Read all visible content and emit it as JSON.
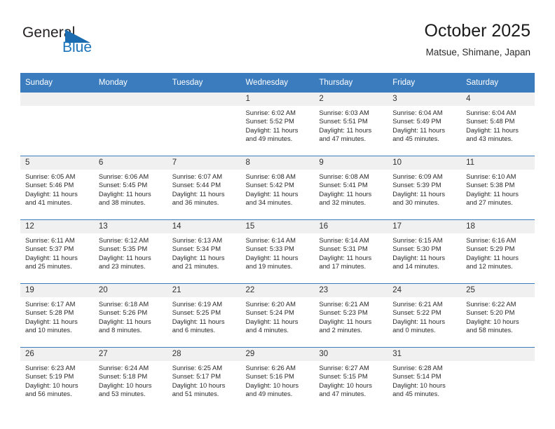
{
  "brand": {
    "name_top": "General",
    "name_bottom": "Blue",
    "triangle_color": "#1b6cb0",
    "blue_text_color": "#1b74bb"
  },
  "header": {
    "title": "October 2025",
    "subtitle": "Matsue, Shimane, Japan"
  },
  "theme": {
    "header_row_bg": "#3a7cbe",
    "daynum_bg": "#f0f0f0",
    "page_bg": "#ffffff",
    "text_color": "#2a2a2a"
  },
  "labels": {
    "sunrise_prefix": "Sunrise:",
    "sunset_prefix": "Sunset:",
    "daylight_prefix": "Daylight:"
  },
  "weekdays": [
    "Sunday",
    "Monday",
    "Tuesday",
    "Wednesday",
    "Thursday",
    "Friday",
    "Saturday"
  ],
  "weeks": [
    [
      {
        "day": "",
        "sunrise": "",
        "sunset": "",
        "daylight": "",
        "blank": true
      },
      {
        "day": "",
        "sunrise": "",
        "sunset": "",
        "daylight": "",
        "blank": true
      },
      {
        "day": "",
        "sunrise": "",
        "sunset": "",
        "daylight": "",
        "blank": true
      },
      {
        "day": "1",
        "sunrise": "Sunrise: 6:02 AM",
        "sunset": "Sunset: 5:52 PM",
        "daylight": "Daylight: 11 hours and 49 minutes."
      },
      {
        "day": "2",
        "sunrise": "Sunrise: 6:03 AM",
        "sunset": "Sunset: 5:51 PM",
        "daylight": "Daylight: 11 hours and 47 minutes."
      },
      {
        "day": "3",
        "sunrise": "Sunrise: 6:04 AM",
        "sunset": "Sunset: 5:49 PM",
        "daylight": "Daylight: 11 hours and 45 minutes."
      },
      {
        "day": "4",
        "sunrise": "Sunrise: 6:04 AM",
        "sunset": "Sunset: 5:48 PM",
        "daylight": "Daylight: 11 hours and 43 minutes."
      }
    ],
    [
      {
        "day": "5",
        "sunrise": "Sunrise: 6:05 AM",
        "sunset": "Sunset: 5:46 PM",
        "daylight": "Daylight: 11 hours and 41 minutes."
      },
      {
        "day": "6",
        "sunrise": "Sunrise: 6:06 AM",
        "sunset": "Sunset: 5:45 PM",
        "daylight": "Daylight: 11 hours and 38 minutes."
      },
      {
        "day": "7",
        "sunrise": "Sunrise: 6:07 AM",
        "sunset": "Sunset: 5:44 PM",
        "daylight": "Daylight: 11 hours and 36 minutes."
      },
      {
        "day": "8",
        "sunrise": "Sunrise: 6:08 AM",
        "sunset": "Sunset: 5:42 PM",
        "daylight": "Daylight: 11 hours and 34 minutes."
      },
      {
        "day": "9",
        "sunrise": "Sunrise: 6:08 AM",
        "sunset": "Sunset: 5:41 PM",
        "daylight": "Daylight: 11 hours and 32 minutes."
      },
      {
        "day": "10",
        "sunrise": "Sunrise: 6:09 AM",
        "sunset": "Sunset: 5:39 PM",
        "daylight": "Daylight: 11 hours and 30 minutes."
      },
      {
        "day": "11",
        "sunrise": "Sunrise: 6:10 AM",
        "sunset": "Sunset: 5:38 PM",
        "daylight": "Daylight: 11 hours and 27 minutes."
      }
    ],
    [
      {
        "day": "12",
        "sunrise": "Sunrise: 6:11 AM",
        "sunset": "Sunset: 5:37 PM",
        "daylight": "Daylight: 11 hours and 25 minutes."
      },
      {
        "day": "13",
        "sunrise": "Sunrise: 6:12 AM",
        "sunset": "Sunset: 5:35 PM",
        "daylight": "Daylight: 11 hours and 23 minutes."
      },
      {
        "day": "14",
        "sunrise": "Sunrise: 6:13 AM",
        "sunset": "Sunset: 5:34 PM",
        "daylight": "Daylight: 11 hours and 21 minutes."
      },
      {
        "day": "15",
        "sunrise": "Sunrise: 6:14 AM",
        "sunset": "Sunset: 5:33 PM",
        "daylight": "Daylight: 11 hours and 19 minutes."
      },
      {
        "day": "16",
        "sunrise": "Sunrise: 6:14 AM",
        "sunset": "Sunset: 5:31 PM",
        "daylight": "Daylight: 11 hours and 17 minutes."
      },
      {
        "day": "17",
        "sunrise": "Sunrise: 6:15 AM",
        "sunset": "Sunset: 5:30 PM",
        "daylight": "Daylight: 11 hours and 14 minutes."
      },
      {
        "day": "18",
        "sunrise": "Sunrise: 6:16 AM",
        "sunset": "Sunset: 5:29 PM",
        "daylight": "Daylight: 11 hours and 12 minutes."
      }
    ],
    [
      {
        "day": "19",
        "sunrise": "Sunrise: 6:17 AM",
        "sunset": "Sunset: 5:28 PM",
        "daylight": "Daylight: 11 hours and 10 minutes."
      },
      {
        "day": "20",
        "sunrise": "Sunrise: 6:18 AM",
        "sunset": "Sunset: 5:26 PM",
        "daylight": "Daylight: 11 hours and 8 minutes."
      },
      {
        "day": "21",
        "sunrise": "Sunrise: 6:19 AM",
        "sunset": "Sunset: 5:25 PM",
        "daylight": "Daylight: 11 hours and 6 minutes."
      },
      {
        "day": "22",
        "sunrise": "Sunrise: 6:20 AM",
        "sunset": "Sunset: 5:24 PM",
        "daylight": "Daylight: 11 hours and 4 minutes."
      },
      {
        "day": "23",
        "sunrise": "Sunrise: 6:21 AM",
        "sunset": "Sunset: 5:23 PM",
        "daylight": "Daylight: 11 hours and 2 minutes."
      },
      {
        "day": "24",
        "sunrise": "Sunrise: 6:21 AM",
        "sunset": "Sunset: 5:22 PM",
        "daylight": "Daylight: 11 hours and 0 minutes."
      },
      {
        "day": "25",
        "sunrise": "Sunrise: 6:22 AM",
        "sunset": "Sunset: 5:20 PM",
        "daylight": "Daylight: 10 hours and 58 minutes."
      }
    ],
    [
      {
        "day": "26",
        "sunrise": "Sunrise: 6:23 AM",
        "sunset": "Sunset: 5:19 PM",
        "daylight": "Daylight: 10 hours and 56 minutes."
      },
      {
        "day": "27",
        "sunrise": "Sunrise: 6:24 AM",
        "sunset": "Sunset: 5:18 PM",
        "daylight": "Daylight: 10 hours and 53 minutes."
      },
      {
        "day": "28",
        "sunrise": "Sunrise: 6:25 AM",
        "sunset": "Sunset: 5:17 PM",
        "daylight": "Daylight: 10 hours and 51 minutes."
      },
      {
        "day": "29",
        "sunrise": "Sunrise: 6:26 AM",
        "sunset": "Sunset: 5:16 PM",
        "daylight": "Daylight: 10 hours and 49 minutes."
      },
      {
        "day": "30",
        "sunrise": "Sunrise: 6:27 AM",
        "sunset": "Sunset: 5:15 PM",
        "daylight": "Daylight: 10 hours and 47 minutes."
      },
      {
        "day": "31",
        "sunrise": "Sunrise: 6:28 AM",
        "sunset": "Sunset: 5:14 PM",
        "daylight": "Daylight: 10 hours and 45 minutes."
      },
      {
        "day": "",
        "sunrise": "",
        "sunset": "",
        "daylight": "",
        "blank": true
      }
    ]
  ]
}
